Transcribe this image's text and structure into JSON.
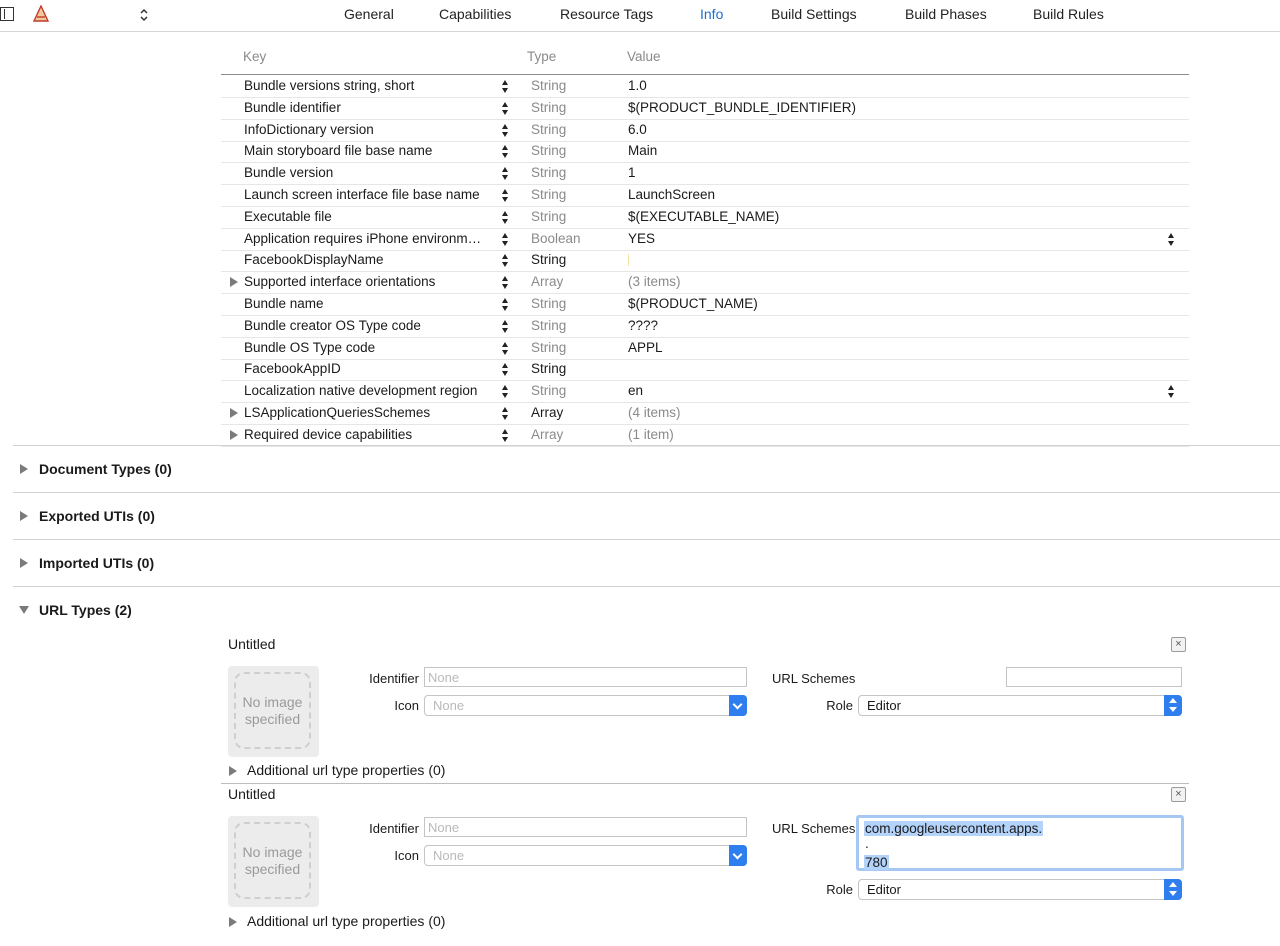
{
  "tabs": [
    "General",
    "Capabilities",
    "Resource Tags",
    "Info",
    "Build Settings",
    "Build Phases",
    "Build Rules"
  ],
  "active_tab": "Info",
  "plist": {
    "headers": {
      "key": "Key",
      "type": "Type",
      "value": "Value"
    },
    "rows": [
      {
        "key": "Bundle versions string, short",
        "type": "String",
        "value": "1.0"
      },
      {
        "key": "Bundle identifier",
        "type": "String",
        "value": "$(PRODUCT_BUNDLE_IDENTIFIER)"
      },
      {
        "key": "InfoDictionary version",
        "type": "String",
        "value": "6.0"
      },
      {
        "key": "Main storyboard file base name",
        "type": "String",
        "value": "Main"
      },
      {
        "key": "Bundle version",
        "type": "String",
        "value": "1"
      },
      {
        "key": "Launch screen interface file base name",
        "type": "String",
        "value": "LaunchScreen"
      },
      {
        "key": "Executable file",
        "type": "String",
        "value": "$(EXECUTABLE_NAME)"
      },
      {
        "key": "Application requires iPhone environm…",
        "type": "Boolean",
        "value": "YES"
      },
      {
        "key": "FacebookDisplayName",
        "type": "String",
        "value": ""
      },
      {
        "key": "Supported interface orientations",
        "type": "Array",
        "value": "(3 items)"
      },
      {
        "key": "Bundle name",
        "type": "String",
        "value": "$(PRODUCT_NAME)"
      },
      {
        "key": "Bundle creator OS Type code",
        "type": "String",
        "value": "????"
      },
      {
        "key": "Bundle OS Type code",
        "type": "String",
        "value": "APPL"
      },
      {
        "key": "FacebookAppID",
        "type": "String",
        "value": ""
      },
      {
        "key": "Localization native development region",
        "type": "String",
        "value": "en"
      },
      {
        "key": "LSApplicationQueriesSchemes",
        "type": "Array",
        "value": "(4 items)"
      },
      {
        "key": "Required device capabilities",
        "type": "Array",
        "value": "(1 item)"
      }
    ]
  },
  "sections": [
    {
      "title": "Document Types (0)"
    },
    {
      "title": "Exported UTIs (0)"
    },
    {
      "title": "Imported UTIs (0)"
    },
    {
      "title": "URL Types (2)"
    }
  ],
  "url_types": [
    {
      "title": "Untitled",
      "image_text": "No image specified",
      "identifier_label": "Identifier",
      "identifier_placeholder": "None",
      "icon_label": "Icon",
      "icon_placeholder": "None",
      "schemes_label": "URL Schemes",
      "schemes_lines": [],
      "role_label": "Role",
      "role_value": "Editor",
      "additional": "Additional url type properties (0)"
    },
    {
      "title": "Untitled",
      "image_text": "No image specified",
      "identifier_label": "Identifier",
      "identifier_placeholder": "None",
      "icon_label": "Icon",
      "icon_placeholder": "None",
      "schemes_label": "URL Schemes",
      "schemes_lines": [
        "com.googleusercontent.apps.",
        ".",
        "780"
      ],
      "role_label": "Role",
      "role_value": "Editor",
      "additional": "Additional url type properties (0)"
    }
  ],
  "colors": {
    "accent": "#1a6fd1",
    "selection": "#b4d3fb",
    "popup_button": "#2f7ef0"
  }
}
